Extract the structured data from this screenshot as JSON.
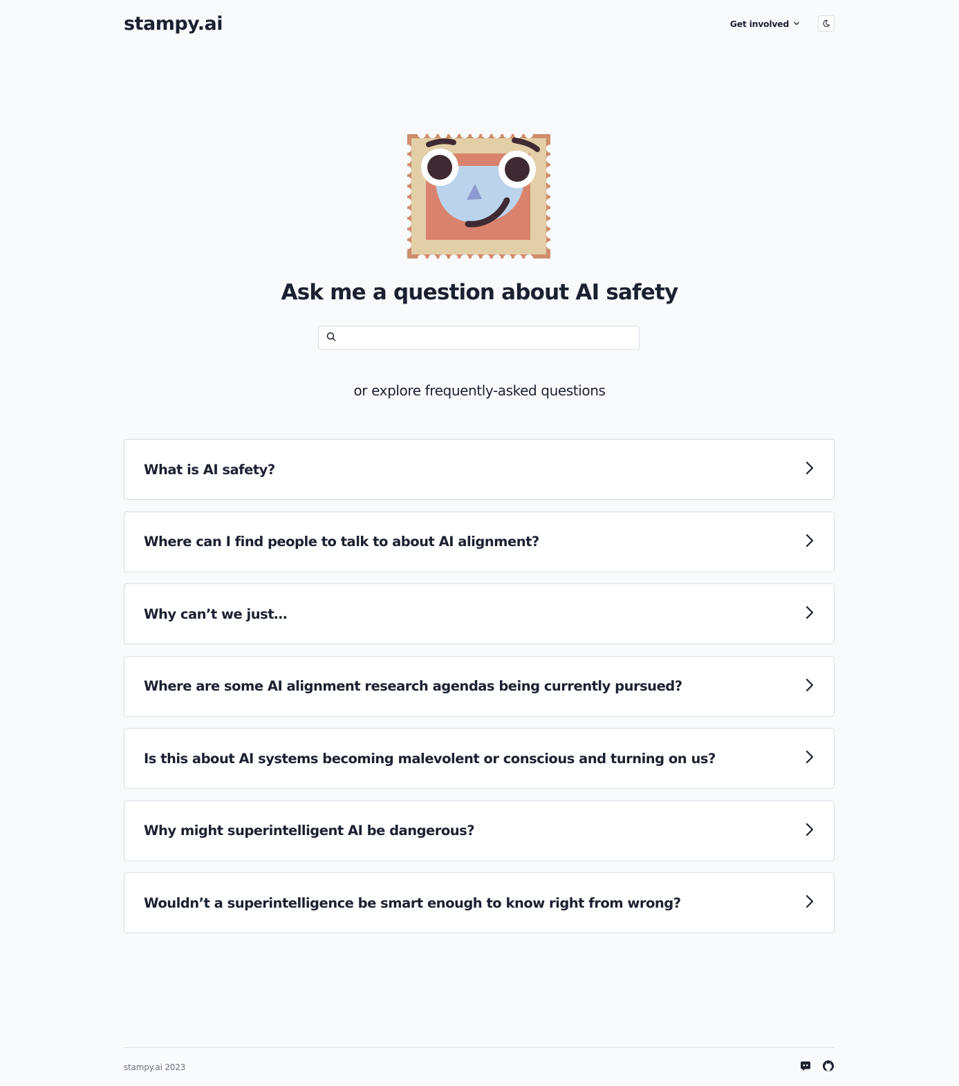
{
  "header": {
    "logo": "stampy.ai",
    "nav_get_involved": "Get involved",
    "theme_toggle_icon": "moon-icon"
  },
  "hero": {
    "title": "Ask me a question about AI safety",
    "search_placeholder": "",
    "search_icon": "search-icon",
    "explore_text": "or explore frequently-asked questions"
  },
  "faq": [
    {
      "label": "What is AI safety?"
    },
    {
      "label": "Where can I find people to talk to about AI alignment?"
    },
    {
      "label": "Why can’t we just…"
    },
    {
      "label": "Where are some AI alignment research agendas being currently pursued?"
    },
    {
      "label": "Is this about AI systems becoming malevolent or conscious and turning on us?"
    },
    {
      "label": "Why might superintelligent AI be dangerous?"
    },
    {
      "label": "Wouldn’t a superintelligence be smart enough to know right from wrong?"
    }
  ],
  "footer": {
    "copyright": "stampy.ai 2023",
    "icons": [
      "discord-icon",
      "github-icon"
    ]
  },
  "colors": {
    "background": "#f8fafc",
    "text": "#1b2130",
    "border": "#d9dde4",
    "stamp_frame": "#e2cfa8",
    "stamp_perforation": "#cf8d6b",
    "stamp_inner": "#d9826d",
    "face": "#bcd3ec",
    "features": "#3f2a33",
    "nose": "#8d9bd0"
  }
}
